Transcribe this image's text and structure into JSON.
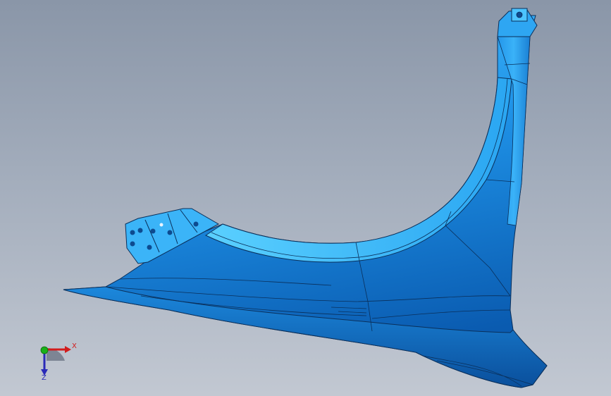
{
  "triad": {
    "x_label": "X",
    "z_label": "Z"
  },
  "colors": {
    "part_base": "#1e90e6",
    "part_light": "#56c7ff",
    "part_dark": "#0b5fb0",
    "edge": "#0a2f5a",
    "background_top": "#8a96a8",
    "background_bottom": "#c2c8d2",
    "axis_x": "#d21c1c",
    "axis_y": "#19b019",
    "axis_z": "#2a2ab8"
  }
}
